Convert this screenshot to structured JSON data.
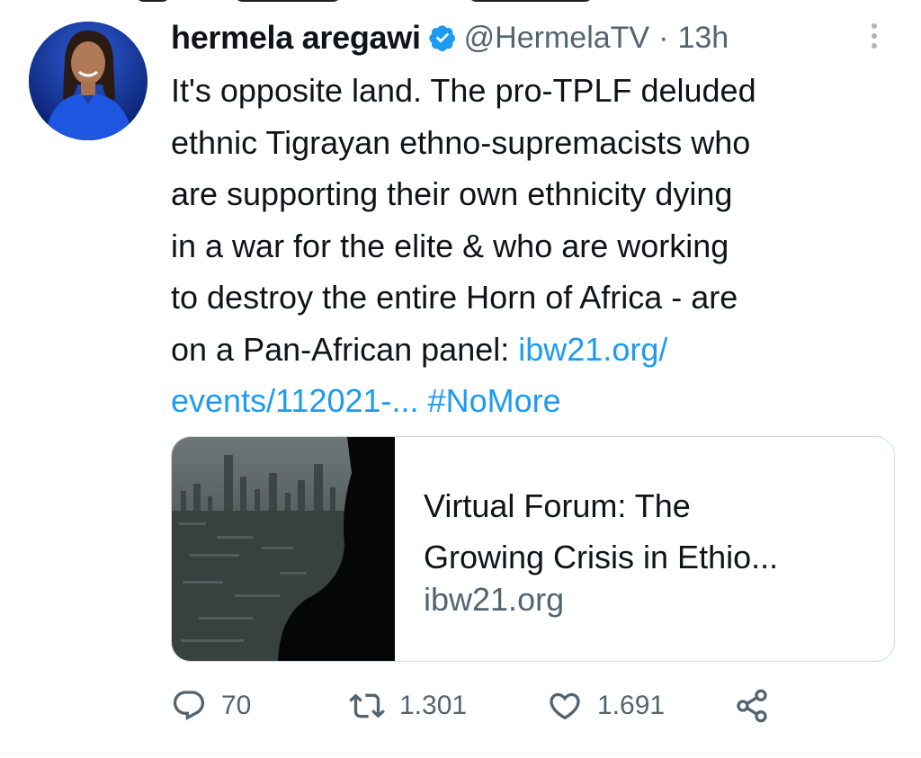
{
  "tweet": {
    "author": {
      "name": "hermela aregawi",
      "handle": "@HermelaTV",
      "separator": "·",
      "time": "13h"
    },
    "text_lines": [
      "It's opposite land. The pro-TPLF deluded",
      "ethnic Tigrayan ethno-supremacists who",
      "are supporting their own ethnicity dying",
      "in a war for the elite & who are working",
      "to destroy the entire Horn of Africa - are",
      "on a Pan-African panel: "
    ],
    "link_part1": "ibw21.org/",
    "link_part2": "events/112021-...",
    "hashtag": "#NoMore",
    "card": {
      "title_line1": "Virtual Forum: The",
      "title_line2": "Growing Crisis in Ethio...",
      "domain": "ibw21.org"
    },
    "actions": {
      "replies": "70",
      "retweets": "1.301",
      "likes": "1.691"
    }
  },
  "colors": {
    "link": "#1d9bf0",
    "text": "#0f1419",
    "secondary": "#536471",
    "verified": "#1d9bf0"
  },
  "icons": [
    "verified-badge-icon",
    "more-options-icon",
    "reply-icon",
    "retweet-icon",
    "like-icon",
    "share-icon"
  ]
}
